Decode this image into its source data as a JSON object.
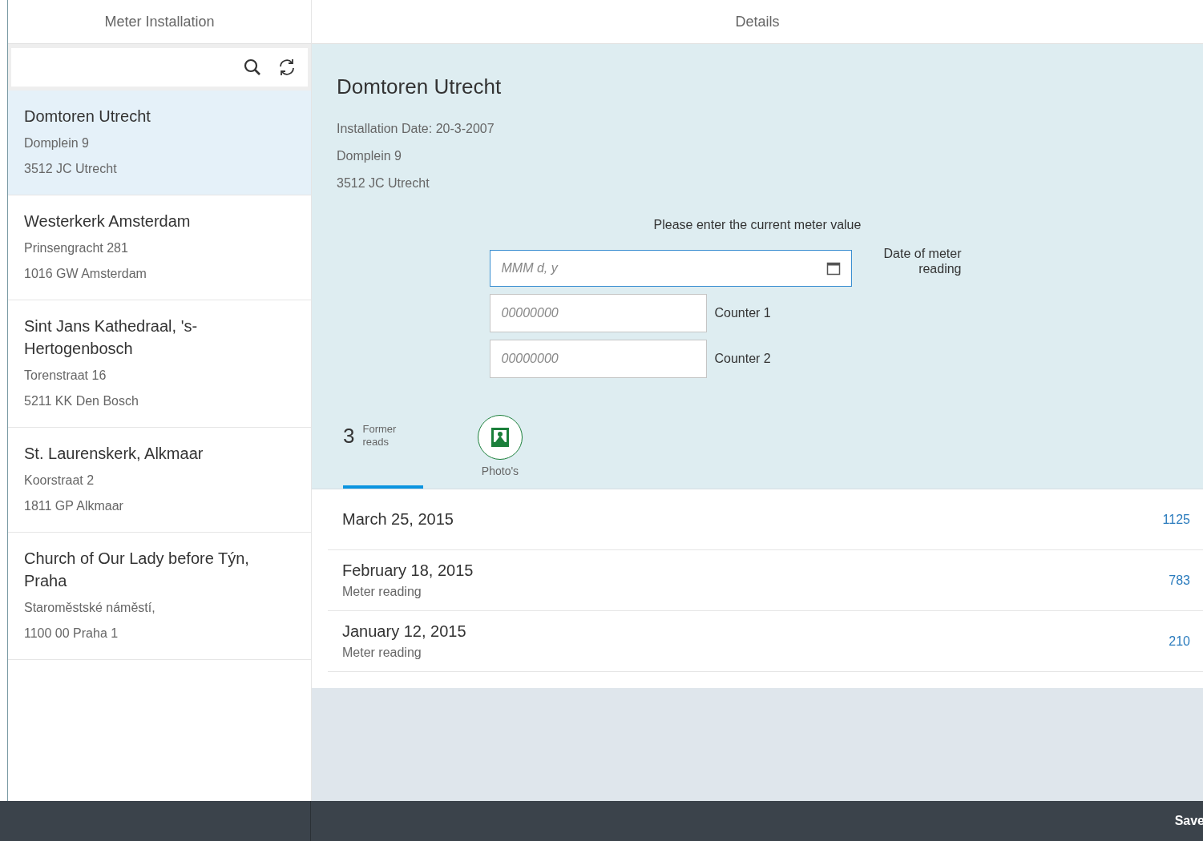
{
  "master": {
    "title": "Meter Installation",
    "items": [
      {
        "title": "Domtoren Utrecht",
        "lines": [
          "Domplein 9",
          "3512 JC Utrecht"
        ],
        "selected": true
      },
      {
        "title": "Westerkerk Amsterdam",
        "lines": [
          "Prinsengracht 281",
          "1016 GW Amsterdam"
        ],
        "selected": false
      },
      {
        "title": "Sint Jans Kathedraal, 's-Hertogenbosch",
        "lines": [
          "Torenstraat 16",
          "5211 KK Den Bosch"
        ],
        "selected": false
      },
      {
        "title": "St. Laurenskerk, Alkmaar",
        "lines": [
          "Koorstraat 2",
          "1811 GP Alkmaar"
        ],
        "selected": false
      },
      {
        "title": "Church of Our Lady before Týn, Praha",
        "lines": [
          "Staroměstské náměstí,",
          "1100 00 Praha 1"
        ],
        "selected": false
      }
    ]
  },
  "detail": {
    "title": "Details",
    "heading": "Domtoren Utrecht",
    "info": [
      "Installation Date: 20-3-2007",
      "Domplein 9",
      "3512 JC Utrecht"
    ],
    "form": {
      "prompt": "Please enter the current meter value",
      "fields": [
        {
          "kind": "date",
          "placeholder": "MMM d, y",
          "label": "Date of meter reading"
        },
        {
          "kind": "number",
          "placeholder": "00000000",
          "label": "Counter 1"
        },
        {
          "kind": "number",
          "placeholder": "00000000",
          "label": "Counter 2"
        }
      ]
    },
    "tabs": [
      {
        "kind": "count",
        "count": "3",
        "label": "Former reads",
        "selected": true
      },
      {
        "kind": "icon",
        "label": "Photo's",
        "selected": false
      }
    ],
    "readings": [
      {
        "date": "March 25, 2015",
        "value": "1125"
      },
      {
        "date": "February 18, 2015",
        "subtitle": "Meter reading",
        "value": "783"
      },
      {
        "date": "January 12, 2015",
        "subtitle": "Meter reading",
        "value": "210"
      }
    ]
  },
  "footer": {
    "buttons": [
      "Save"
    ]
  }
}
